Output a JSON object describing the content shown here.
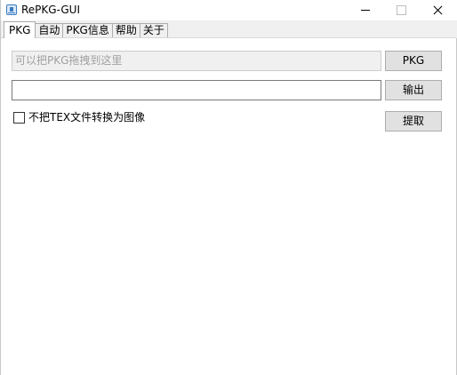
{
  "window": {
    "title": "RePKG-GUI",
    "icon": "app-icon"
  },
  "tabs": [
    {
      "label": "PKG",
      "active": true
    },
    {
      "label": "自动",
      "active": false
    },
    {
      "label": "PKG信息",
      "active": false
    },
    {
      "label": "帮助",
      "active": false
    },
    {
      "label": "关于",
      "active": false
    }
  ],
  "pkg_panel": {
    "pkg_input": {
      "value": "",
      "placeholder": "可以把PKG拖拽到这里"
    },
    "pkg_button_label": "PKG",
    "output_input": {
      "value": "",
      "placeholder": ""
    },
    "output_button_label": "输出",
    "no_tex_checkbox": {
      "label": "不把TEX文件转换为图像",
      "checked": false
    },
    "extract_button_label": "提取"
  }
}
